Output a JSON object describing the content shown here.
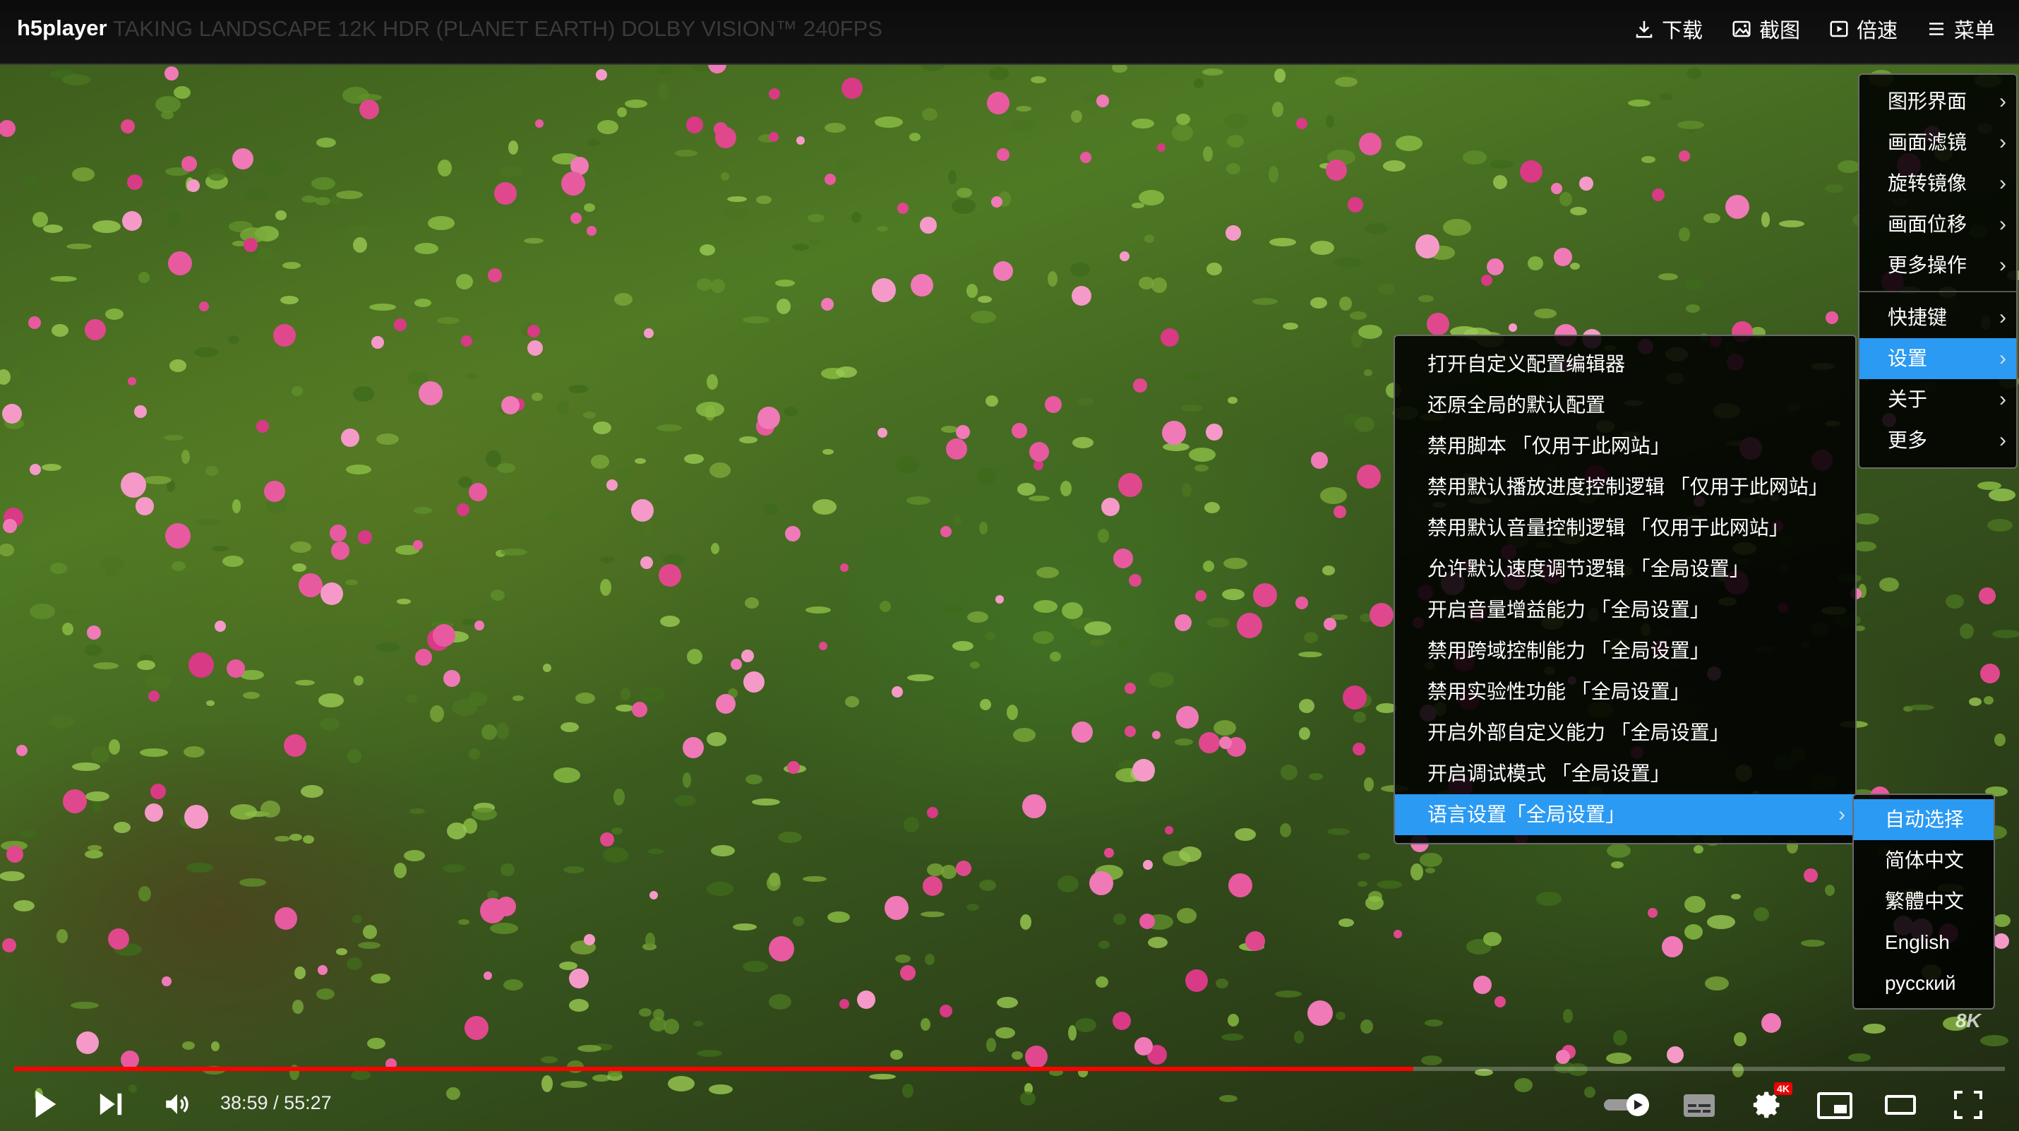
{
  "app": {
    "brand": "h5player",
    "video_title": "TAKING LANDSCAPE 12K HDR (PLANET EARTH) DOLBY VISION™ 240FPS"
  },
  "top_actions": [
    {
      "label": "下载",
      "icon": "download-icon"
    },
    {
      "label": "截图",
      "icon": "screenshot-icon"
    },
    {
      "label": "倍速",
      "icon": "speed-icon"
    },
    {
      "label": "菜单",
      "icon": "menu-icon"
    }
  ],
  "main_menu": {
    "group1": [
      {
        "label": "图形界面"
      },
      {
        "label": "画面滤镜"
      },
      {
        "label": "旋转镜像"
      },
      {
        "label": "画面位移"
      },
      {
        "label": "更多操作"
      }
    ],
    "group2": [
      {
        "label": "快捷键"
      },
      {
        "label": "设置",
        "selected": true
      },
      {
        "label": "关于"
      },
      {
        "label": "更多"
      }
    ]
  },
  "settings_menu": [
    {
      "label": "打开自定义配置编辑器"
    },
    {
      "label": "还原全局的默认配置"
    },
    {
      "label": "禁用脚本 「仅用于此网站」"
    },
    {
      "label": "禁用默认播放进度控制逻辑 「仅用于此网站」"
    },
    {
      "label": "禁用默认音量控制逻辑 「仅用于此网站」"
    },
    {
      "label": "允许默认速度调节逻辑 「全局设置」"
    },
    {
      "label": "开启音量增益能力 「全局设置」"
    },
    {
      "label": "禁用跨域控制能力 「全局设置」"
    },
    {
      "label": "禁用实验性功能 「全局设置」"
    },
    {
      "label": "开启外部自定义能力 「全局设置」"
    },
    {
      "label": "开启调试模式 「全局设置」"
    },
    {
      "label": "语言设置「全局设置」",
      "selected": true,
      "has_submenu": true
    }
  ],
  "language_menu": [
    {
      "label": "自动选择",
      "selected": true
    },
    {
      "label": "简体中文"
    },
    {
      "label": "繁體中文"
    },
    {
      "label": "English"
    },
    {
      "label": "русский"
    }
  ],
  "player": {
    "time": "38:59 / 55:27",
    "progress": 0.703,
    "quality_badge": "4K",
    "watermark": "8K"
  },
  "colors": {
    "accent": "#2b9af3",
    "progress": "#ff0000"
  }
}
